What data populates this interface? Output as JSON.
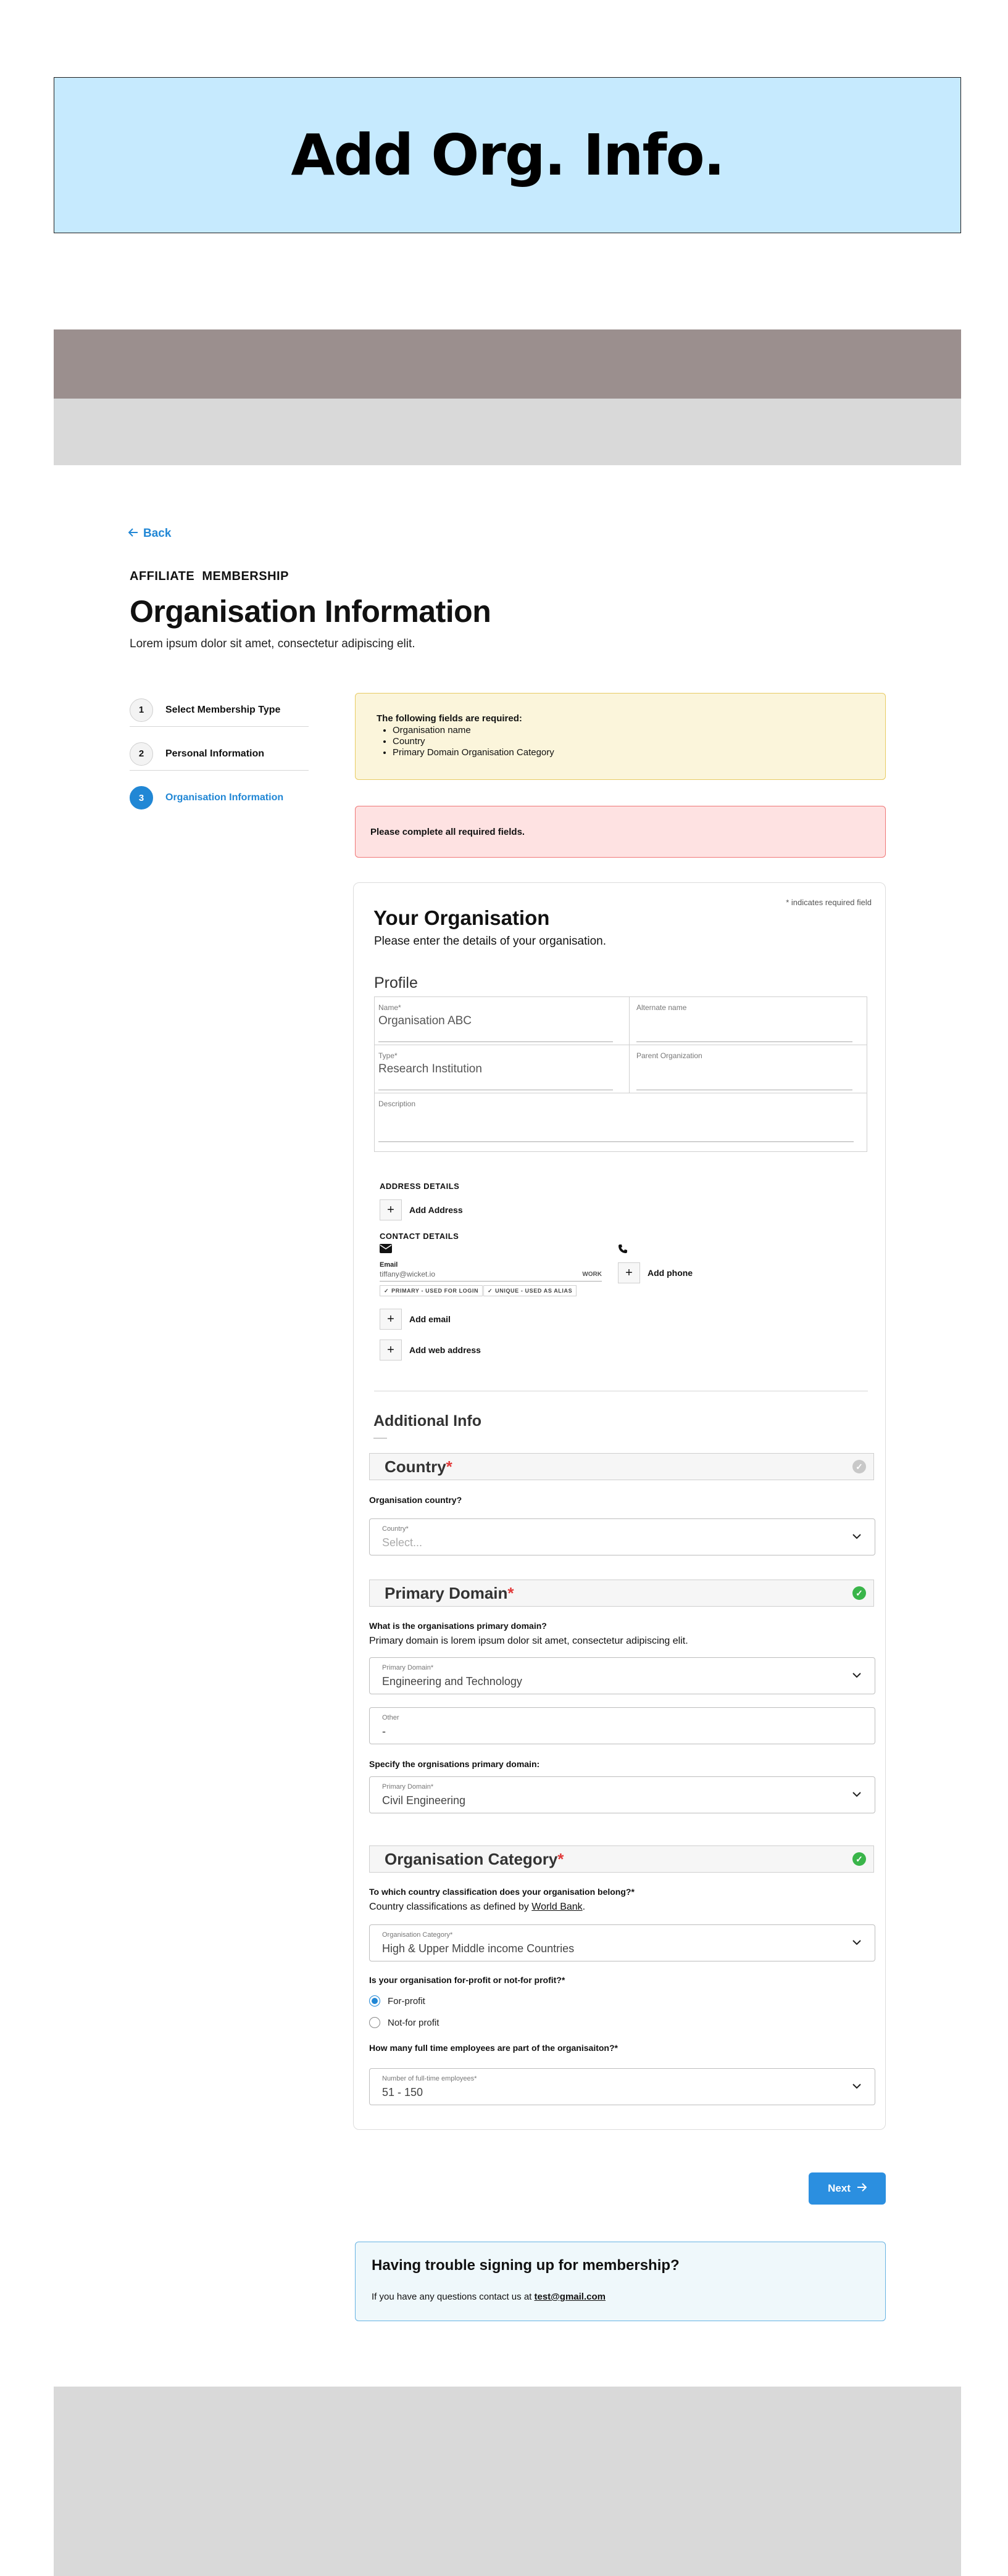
{
  "hero": {
    "title": "Add Org. Info."
  },
  "back_label": "Back",
  "kicker": "AFFILIATE  MEMBERSHIP",
  "page_title": "Organisation Information",
  "page_subtitle": "Lorem ipsum dolor sit amet, consectetur adipiscing elit.",
  "steps": [
    {
      "num": "1",
      "label": "Select Membership Type"
    },
    {
      "num": "2",
      "label": "Personal Information"
    },
    {
      "num": "3",
      "label": "Organisation Information"
    }
  ],
  "warning": {
    "heading": "The following fields are required:",
    "items": [
      "Organisation name",
      "Country",
      "Primary Domain Organisation Category"
    ]
  },
  "error_message": "Please complete all required fields.",
  "card": {
    "required_note": "* indicates required field",
    "title": "Your Organisation",
    "subtitle": "Please enter the details of your organisation.",
    "profile_heading": "Profile",
    "fields": {
      "name_label": "Name*",
      "name_value": "Organisation ABC",
      "alt_name_label": "Alternate name",
      "type_label": "Type*",
      "type_value": "Research Institution",
      "parent_label": "Parent Organization",
      "description_label": "Description"
    },
    "address_label": "ADDRESS DETAILS",
    "add_address": "Add Address",
    "contact_label": "CONTACT DETAILS",
    "email_label": "Email",
    "email_value": "tiffany@wicket.io",
    "email_tag": "WORK",
    "chip_primary": "PRIMARY - USED FOR LOGIN",
    "chip_unique": "UNIQUE - USED AS ALIAS",
    "add_phone": "Add phone",
    "add_email": "Add email",
    "add_web": "Add web address",
    "additional_heading": "Additional Info",
    "country": {
      "bar": "Country",
      "star": "*",
      "question": "Organisation country?",
      "select_label": "Country*",
      "select_placeholder": "Select..."
    },
    "domain": {
      "bar": "Primary Domain",
      "star": "*",
      "question": "What is the organisations primary domain?",
      "help": "Primary domain is lorem ipsum dolor sit amet, consectetur adipiscing elit.",
      "select_label": "Primary Domain*",
      "select_value": "Engineering and Technology",
      "other_label": "Other",
      "other_value": "-",
      "specify_question": "Specify the orgnisations primary domain:",
      "specify_label": "Primary Domain*",
      "specify_value": "Civil Engineering"
    },
    "category": {
      "bar": "Organisation Category",
      "star": "*",
      "question": "To which country classification does your organisation belong?*",
      "help_prefix": "Country classifications as defined by ",
      "help_link": "World Bank",
      "help_suffix": ".",
      "select_label": "Organisation Category*",
      "select_value": "High & Upper Middle income Countries",
      "profit_question": "Is your organisation for-profit or not-for profit?*",
      "radio_for_profit": "For-profit",
      "radio_not_for_profit": "Not-for profit",
      "employees_question": "How many full time employees are part of the organisaiton?*",
      "employees_label": "Number of full-time employees*",
      "employees_value": "51 - 150"
    }
  },
  "next_label": "Next",
  "help": {
    "title": "Having trouble signing up for membership?",
    "text": "If you have any questions contact us at ",
    "email": "test@gmail.com"
  }
}
